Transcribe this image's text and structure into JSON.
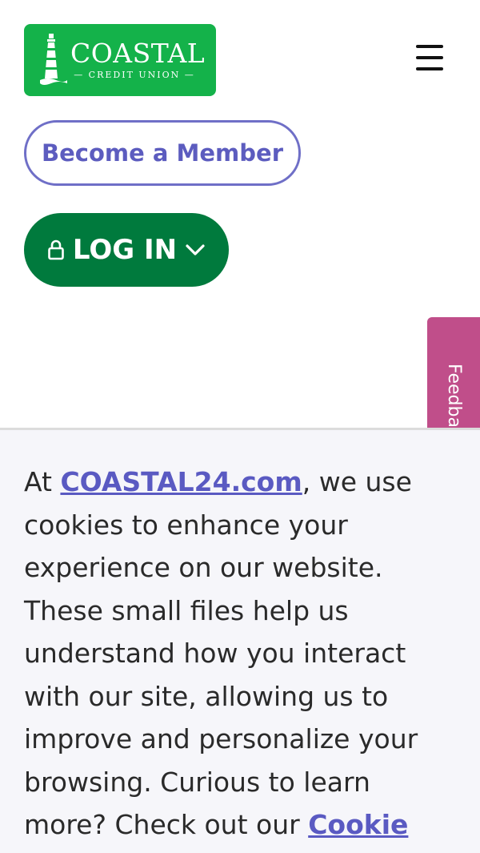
{
  "header": {
    "logo": {
      "name": "COASTAL",
      "tagline": "— CREDIT UNION —",
      "icon": "lighthouse-icon",
      "color": "#14b24a"
    },
    "menu_icon": "hamburger-menu-icon"
  },
  "actions": {
    "become_member_label": "Become a Member",
    "login_label": "LOG IN",
    "login_icon": "lock-icon",
    "login_chevron": "chevron-down-icon",
    "login_color": "#007a3d",
    "become_color": "#5c5cbf"
  },
  "feedback": {
    "label": "Feedback",
    "color": "#c04e8a"
  },
  "cookie_banner": {
    "intro": "At ",
    "site_link": "COASTAL24.com",
    "body": ", we use cookies to enhance your experience on our website. These small files help us understand how you interact with our site, allowing us to improve and personalize your browsing. Curious to learn more? Check out our ",
    "policy_link": "Cookie"
  }
}
